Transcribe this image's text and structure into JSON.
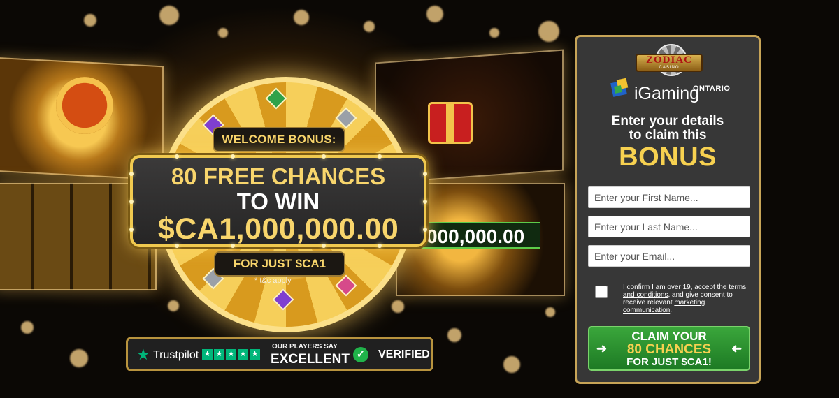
{
  "hero": {
    "welcome_label": "WELCOME BONUS:",
    "offer_line1": "80 FREE CHANCES",
    "offer_line2": "TO WIN",
    "offer_amount": "$CA1,000,000.00",
    "price_label": "FOR JUST $CA1",
    "terms_note": "* t&c apply",
    "background_strip_amount": "000,000.00"
  },
  "trust_bar": {
    "trustpilot_label": "Trustpilot",
    "stars_count": 5,
    "players_say": "OUR PLAYERS SAY",
    "rating_word": "EXCELLENT",
    "verified_label": "VERIFIED"
  },
  "form": {
    "logo_brand": "ZODIAC",
    "logo_sub": "CASINO",
    "igaming_label": "iGaming",
    "ontario_label": "ONTARIO",
    "heading_line1": "Enter your details",
    "heading_line2": "to claim this",
    "heading_bonus": "BONUS",
    "first_name_placeholder": "Enter your First Name...",
    "last_name_placeholder": "Enter your Last Name...",
    "email_placeholder": "Enter your Email...",
    "consent_prefix": "I confirm I am over 19, accept the ",
    "consent_terms_link": "terms and conditions",
    "consent_middle": ", and give consent to receive relevant ",
    "consent_marketing_link": "marketing communication",
    "consent_suffix": ".",
    "cta_line1": "CLAIM YOUR",
    "cta_line2": "80 CHANCES",
    "cta_line3": "FOR JUST $CA1!"
  },
  "colors": {
    "accent_gold": "#f8d56c",
    "panel_bg": "#373737",
    "cta_green": "#2e9333",
    "trustpilot_green": "#00b67a"
  }
}
